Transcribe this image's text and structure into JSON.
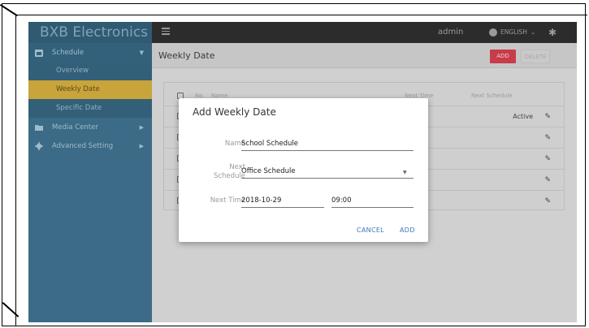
{
  "app": {
    "brand": "BXB Electronics"
  },
  "topbar": {
    "user": "admin",
    "language": "ENGLISH"
  },
  "sidebar": {
    "items": [
      {
        "label": "Schedule",
        "icon": "calendar-icon"
      },
      {
        "label": "Media Center",
        "icon": "folder-icon"
      },
      {
        "label": "Advanced Setting",
        "icon": "gear-icon"
      }
    ],
    "schedule_sub": [
      {
        "label": "Overview"
      },
      {
        "label": "Weekly Date"
      },
      {
        "label": "Specific Date"
      }
    ]
  },
  "page": {
    "title": "Weekly Date",
    "add_label": "ADD",
    "delete_label": "DELETE"
  },
  "table": {
    "headers": {
      "no": "No.",
      "name": "Name",
      "next_time": "Next Time",
      "next_schedule": "Next Schedule"
    },
    "first_row_status": "Active"
  },
  "modal": {
    "title": "Add Weekly Date",
    "name_label": "Name",
    "name_value": "School Schedule",
    "next_schedule_label_1": "Next",
    "next_schedule_label_2": "Schedule",
    "next_schedule_value": "Office Schedule",
    "next_time_label": "Next Time",
    "date_value": "2018-10-29",
    "time_value": "09:00",
    "cancel_label": "CANCEL",
    "add_label": "ADD"
  },
  "colors": {
    "sidebar": "#3b6b86",
    "active_item": "#c9a43a",
    "add_button": "#c83c4a",
    "modal_action": "#3a79b9"
  }
}
